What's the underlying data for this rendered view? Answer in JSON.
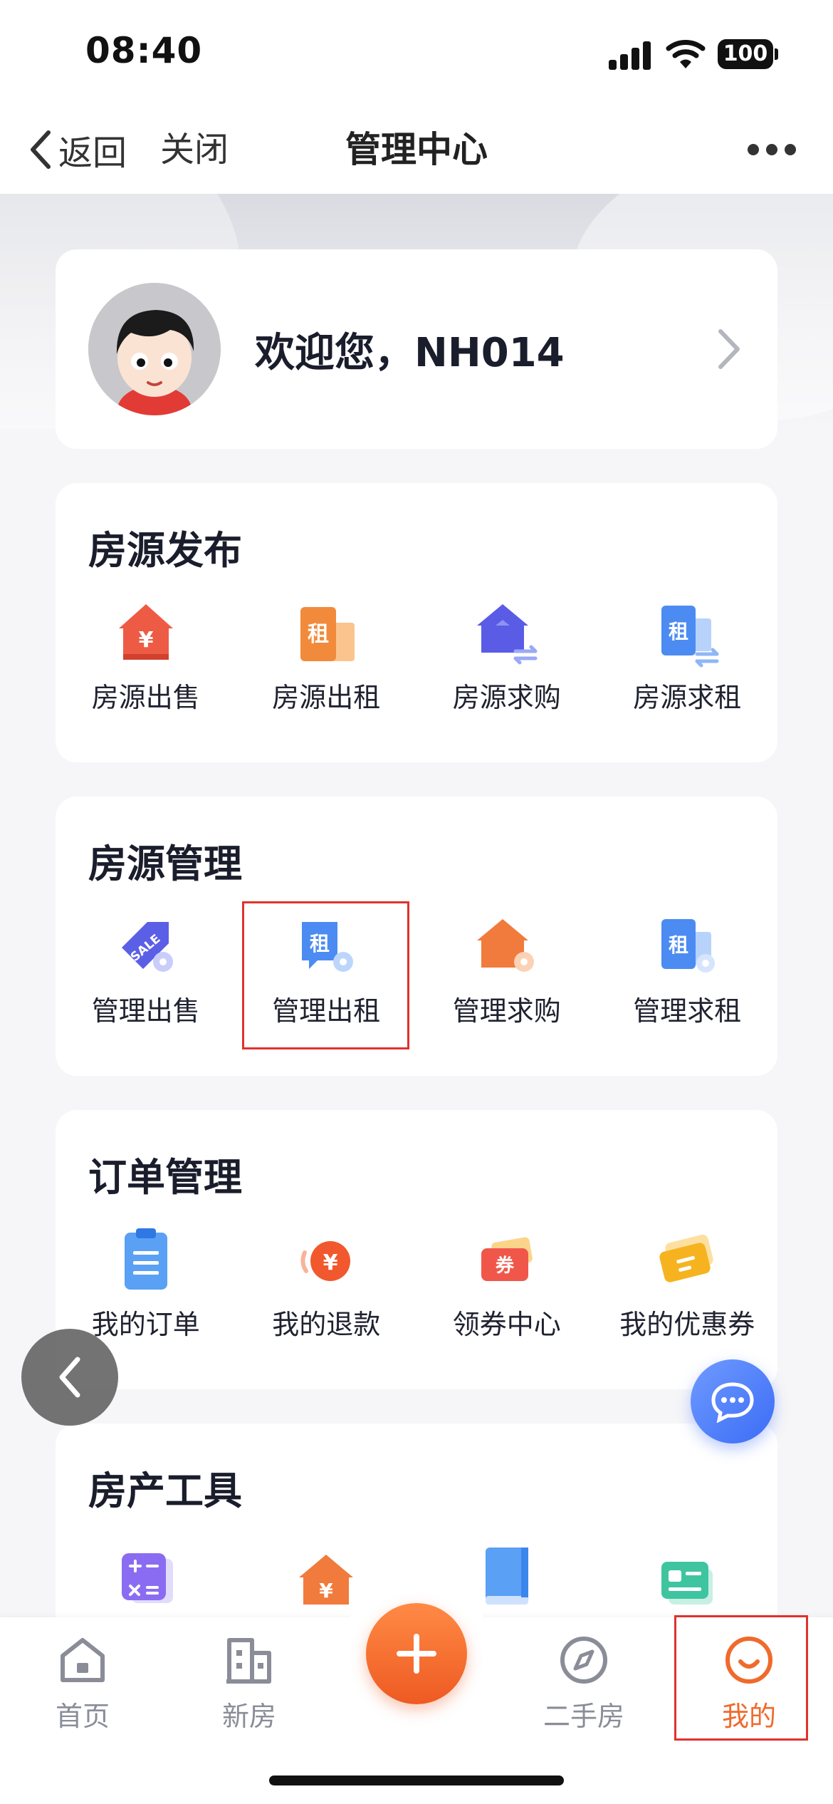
{
  "status_bar": {
    "time": "08:40",
    "battery": "100"
  },
  "nav": {
    "back_label": "返回",
    "close_label": "关闭",
    "title": "管理中心"
  },
  "profile": {
    "welcome": "欢迎您，NH014"
  },
  "sections": {
    "publish": {
      "title": "房源发布",
      "items": [
        {
          "label": "房源出售",
          "icon": "house-sale-icon"
        },
        {
          "label": "房源出租",
          "icon": "rent-tag-icon"
        },
        {
          "label": "房源求购",
          "icon": "house-exchange-icon"
        },
        {
          "label": "房源求租",
          "icon": "rent-exchange-icon"
        }
      ]
    },
    "manage": {
      "title": "房源管理",
      "items": [
        {
          "label": "管理出售",
          "icon": "sale-tag-gear-icon"
        },
        {
          "label": "管理出租",
          "icon": "rent-bubble-gear-icon"
        },
        {
          "label": "管理求购",
          "icon": "house-gear-icon"
        },
        {
          "label": "管理求租",
          "icon": "rent-gear-icon"
        }
      ]
    },
    "orders": {
      "title": "订单管理",
      "items": [
        {
          "label": "我的订单",
          "icon": "clipboard-icon"
        },
        {
          "label": "我的退款",
          "icon": "refund-icon"
        },
        {
          "label": "领券中心",
          "icon": "coupon-center-icon"
        },
        {
          "label": "我的优惠券",
          "icon": "coupon-icon"
        }
      ]
    },
    "tools": {
      "title": "房产工具",
      "items": [
        {
          "icon": "calculator-icon"
        },
        {
          "icon": "house-yuan-icon"
        },
        {
          "icon": "book-icon"
        },
        {
          "icon": "id-card-icon"
        }
      ]
    }
  },
  "icon_glyphs": {
    "yuan": "¥",
    "rent": "租",
    "sale": "SALE",
    "coupon": "券"
  },
  "tab_bar": {
    "home": "首页",
    "new_house": "新房",
    "second_house": "二手房",
    "mine": "我的"
  },
  "colors": {
    "accent": "#f06a2c",
    "highlight": "#e0322e",
    "chat": "#3c6cf6"
  }
}
